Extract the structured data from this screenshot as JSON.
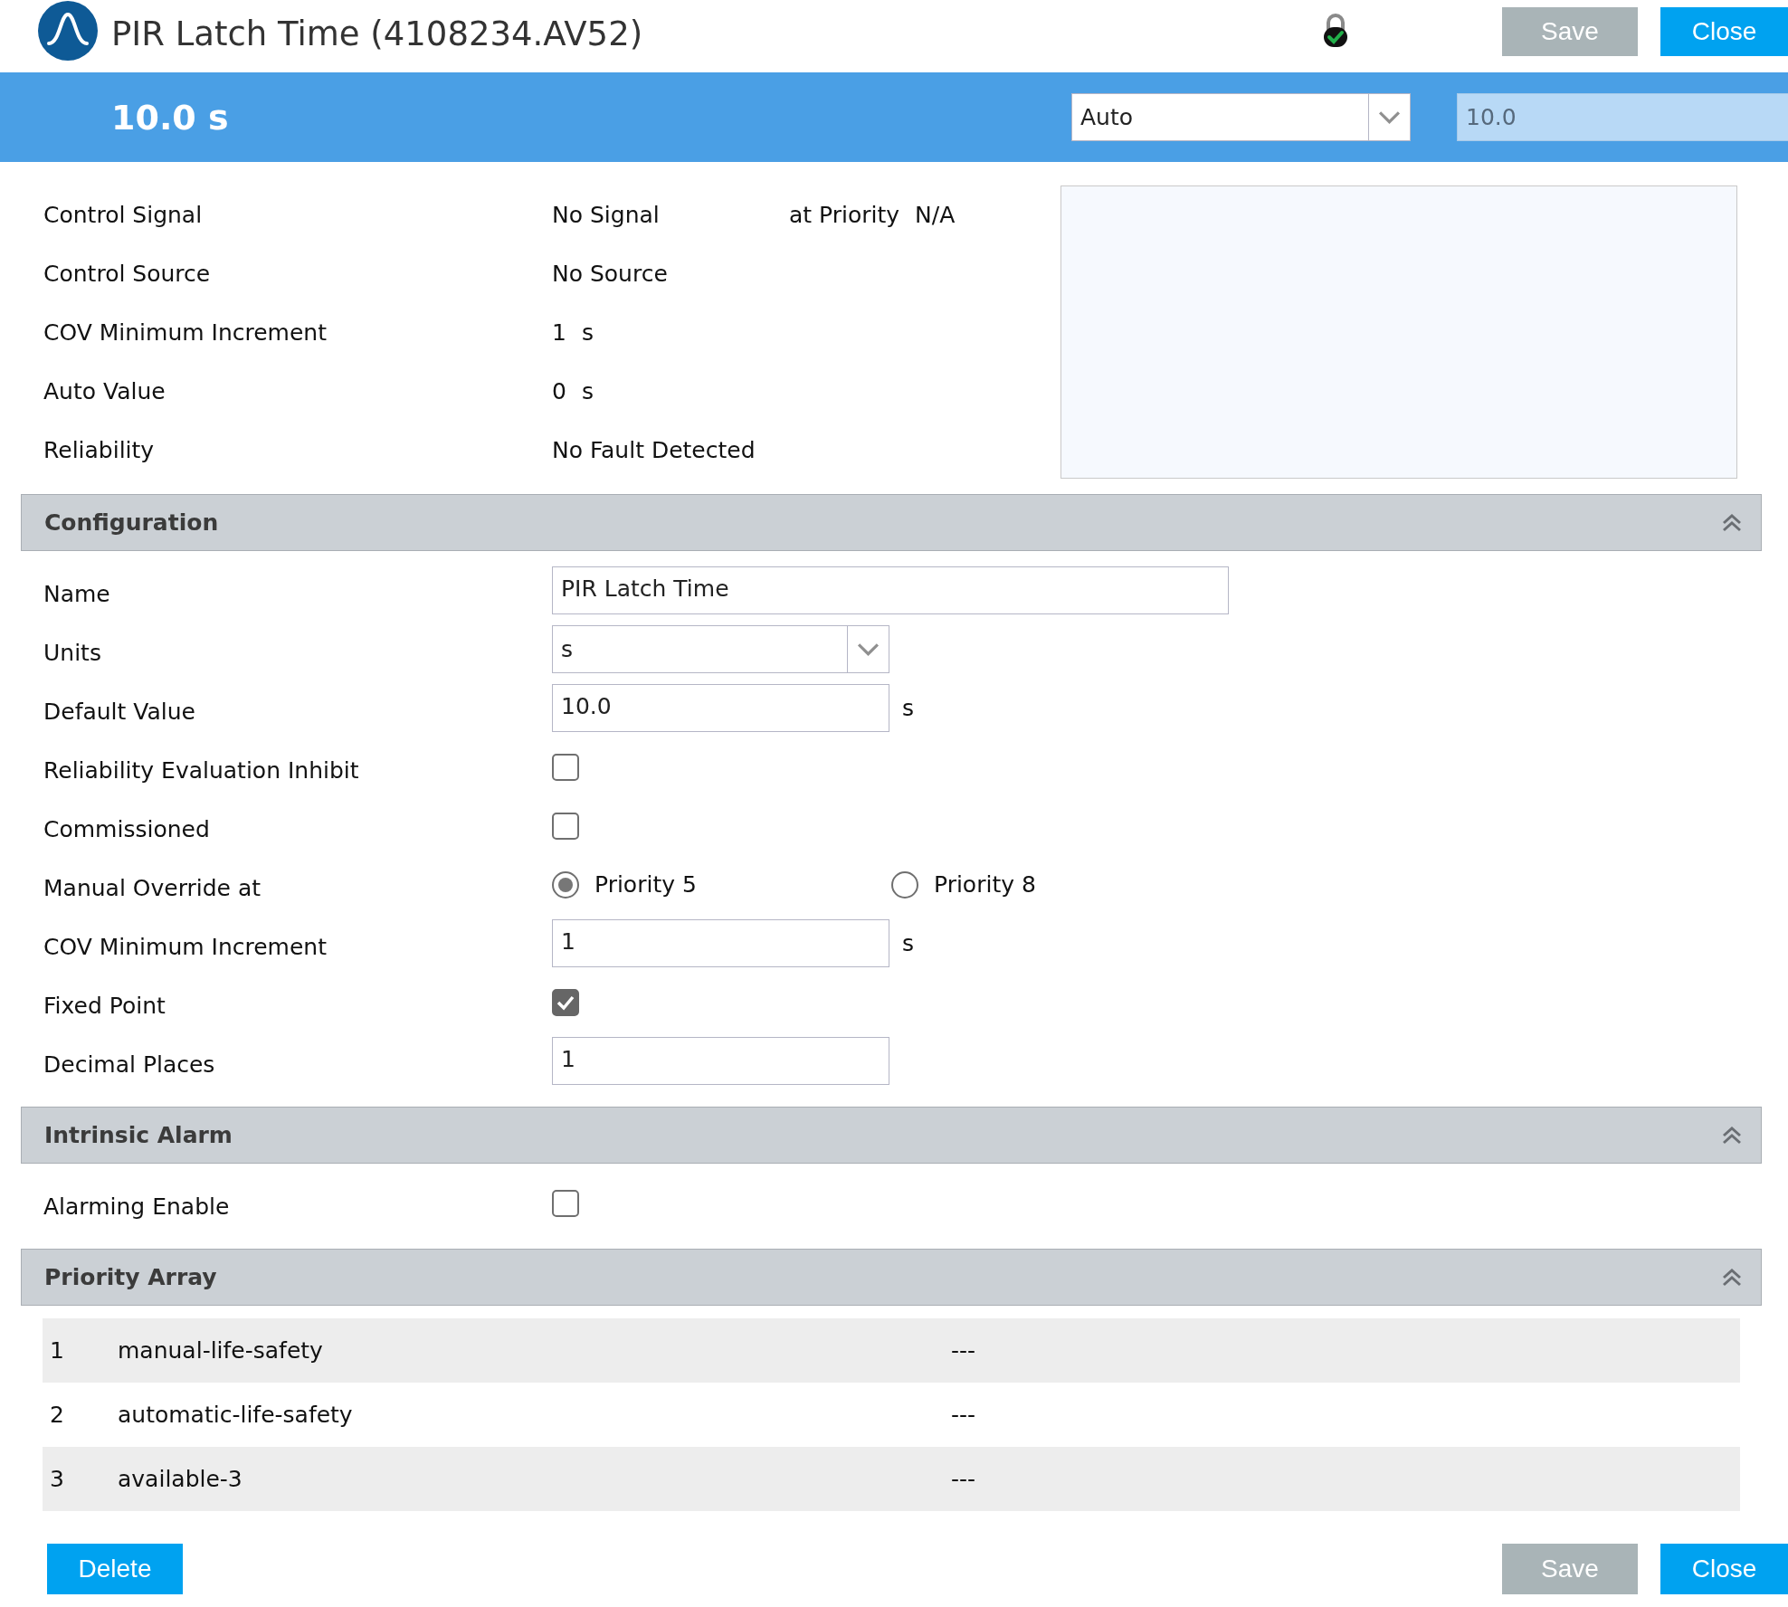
{
  "window": {
    "title": "PIR Latch Time (4108234.AV52)"
  },
  "header_buttons": [
    {
      "label": "Save",
      "disabled": true
    },
    {
      "label": "Close",
      "disabled": false
    }
  ],
  "value_bar": {
    "present_value": "10.0 s",
    "mode": {
      "value": "Auto"
    },
    "override": {
      "value": "10.0",
      "disabled": true
    }
  },
  "status": [
    {
      "label": "Control Signal",
      "value": "No Signal",
      "priority_label": "at Priority",
      "priority_value": "N/A"
    },
    {
      "label": "Control Source",
      "value": "No Source"
    },
    {
      "label": "COV Minimum Increment",
      "value": "1",
      "unit": "s"
    },
    {
      "label": "Auto Value",
      "value": "0",
      "unit": "s"
    },
    {
      "label": "Reliability",
      "value": "No Fault Detected"
    }
  ],
  "sections": [
    {
      "title": "Configuration",
      "expanded": true,
      "fields": [
        {
          "kind": "text",
          "label": "Name",
          "value": "PIR Latch Time"
        },
        {
          "kind": "select",
          "label": "Units",
          "value": "s"
        },
        {
          "kind": "number",
          "label": "Default Value",
          "value": "10.0",
          "unit": "s"
        },
        {
          "kind": "checkbox",
          "label": "Reliability Evaluation Inhibit",
          "checked": false
        },
        {
          "kind": "checkbox",
          "label": "Commissioned",
          "checked": false
        },
        {
          "kind": "radio",
          "label": "Manual Override at",
          "options": [
            {
              "label": "Priority 5",
              "selected": true
            },
            {
              "label": "Priority 8",
              "selected": false
            }
          ]
        },
        {
          "kind": "number",
          "label": "COV Minimum Increment",
          "value": "1",
          "unit": "s"
        },
        {
          "kind": "checkbox",
          "label": "Fixed Point",
          "checked": true
        },
        {
          "kind": "number",
          "label": "Decimal Places",
          "value": "1"
        }
      ]
    },
    {
      "title": "Intrinsic Alarm",
      "expanded": true,
      "fields": [
        {
          "kind": "checkbox",
          "label": "Alarming Enable",
          "checked": false
        }
      ]
    },
    {
      "title": "Priority Array",
      "expanded": true,
      "rows": [
        {
          "index": "1",
          "name": "manual-life-safety",
          "value": "---"
        },
        {
          "index": "2",
          "name": "automatic-life-safety",
          "value": "---"
        },
        {
          "index": "3",
          "name": "available-3",
          "value": "---"
        }
      ]
    }
  ],
  "footer_buttons": [
    {
      "label": "Delete",
      "disabled": false
    },
    {
      "label": "Save",
      "disabled": true
    },
    {
      "label": "Close",
      "disabled": false
    }
  ]
}
